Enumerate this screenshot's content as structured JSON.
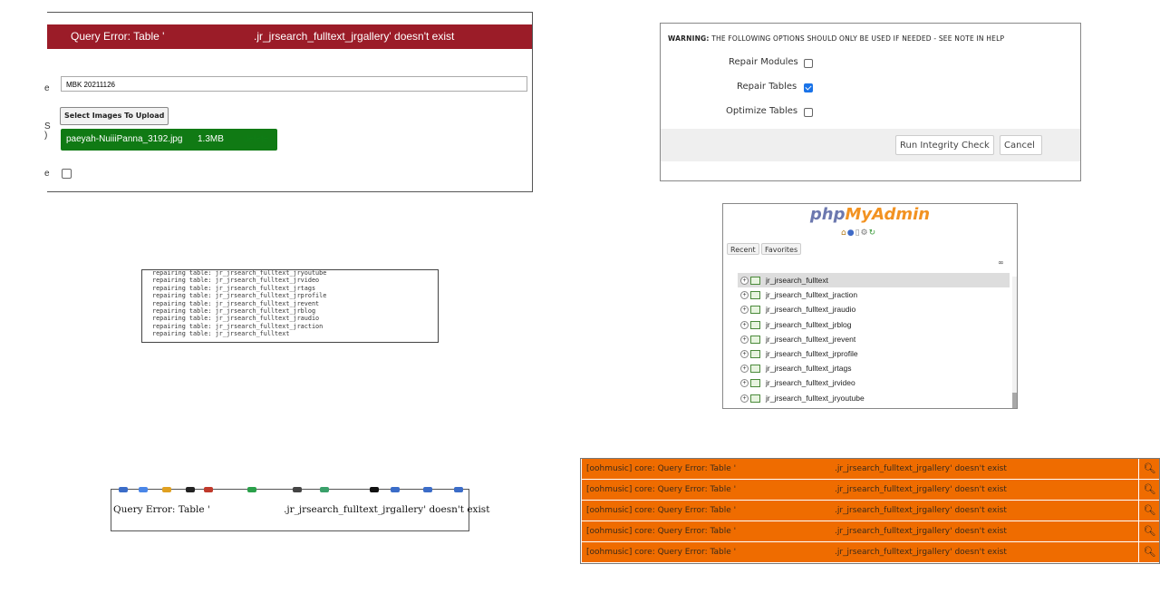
{
  "panel1": {
    "error_left": "Query Error: Table '",
    "error_right": ".jr_jrsearch_fulltext_jrgallery' doesn't exist",
    "title_value": "MBK 20211126",
    "select_images_label": "Select Images To Upload",
    "file_name": "paeyah-NuiiiPanna_3192.jpg",
    "file_size": "1.3MB",
    "file_delete": "delete",
    "edge_labels": [
      "e",
      "S",
      ")",
      "e"
    ]
  },
  "panel2": {
    "warning_bold": "WARNING:",
    "warning_text": " THE FOLLOWING OPTIONS SHOULD ONLY BE USED IF NEEDED - SEE NOTE IN HELP",
    "options": [
      {
        "label": "Repair Modules",
        "checked": false
      },
      {
        "label": "Repair Tables",
        "checked": true
      },
      {
        "label": "Optimize Tables",
        "checked": false
      }
    ],
    "run_button": "Run Integrity Check",
    "cancel_button": "Cancel"
  },
  "panel3": {
    "log_lines": [
      "repairing table: jr_jrsearch_fulltext_jryoutube",
      "repairing table: jr_jrsearch_fulltext_jrvideo",
      "repairing table: jr_jrsearch_fulltext_jrtags",
      "repairing table: jr_jrsearch_fulltext_jrprofile",
      "repairing table: jr_jrsearch_fulltext_jrevent",
      "repairing table: jr_jrsearch_fulltext_jrblog",
      "repairing table: jr_jrsearch_fulltext_jraudio",
      "repairing table: jr_jrsearch_fulltext_jraction",
      "repairing table: jr_jrsearch_fulltext"
    ]
  },
  "panel4": {
    "logo_php": "php",
    "logo_myadmin": "MyAdmin",
    "tab_recent": "Recent",
    "tab_favorites": "Favorites",
    "tables": [
      "jr_jrsearch_fulltext",
      "jr_jrsearch_fulltext_jraction",
      "jr_jrsearch_fulltext_jraudio",
      "jr_jrsearch_fulltext_jrblog",
      "jr_jrsearch_fulltext_jrevent",
      "jr_jrsearch_fulltext_jrprofile",
      "jr_jrsearch_fulltext_jrtags",
      "jr_jrsearch_fulltext_jrvideo",
      "jr_jrsearch_fulltext_jryoutube"
    ],
    "selected_table": "jr_jrsearch_fulltext"
  },
  "panel5": {
    "error_left": "Query Error: Table '",
    "error_right": ".jr_jrsearch_fulltext_jrgallery' doesn't exist"
  },
  "panel6": {
    "rows": [
      {
        "left": "[oohmusic] core: Query Error: Table '",
        "right": ".jr_jrsearch_fulltext_jrgallery' doesn't exist"
      },
      {
        "left": "[oohmusic] core: Query Error: Table '",
        "right": ".jr_jrsearch_fulltext_jrgallery' doesn't exist"
      },
      {
        "left": "[oohmusic] core: Query Error: Table '",
        "right": ".jr_jrsearch_fulltext_jrgallery' doesn't exist"
      },
      {
        "left": "[oohmusic] core: Query Error: Table '",
        "right": ".jr_jrsearch_fulltext_jrgallery' doesn't exist"
      },
      {
        "left": "[oohmusic] core: Query Error: Table '",
        "right": ".jr_jrsearch_fulltext_jrgallery' doesn't exist"
      }
    ],
    "row_color": "#ef6c00"
  }
}
